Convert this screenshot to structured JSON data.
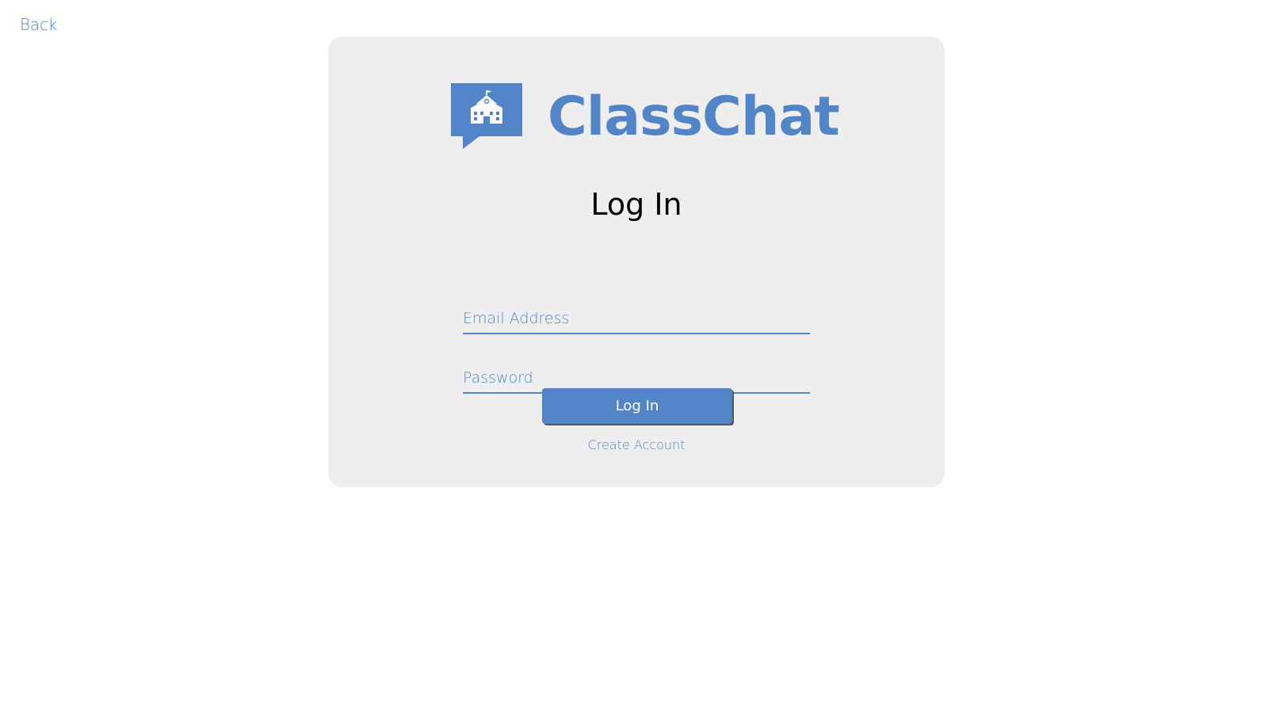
{
  "nav": {
    "back_label": "Back"
  },
  "brand": {
    "name": "ClassChat",
    "icon": "school-chat-bubble-icon"
  },
  "form": {
    "title": "Log In",
    "email_placeholder": "Email Address",
    "password_placeholder": "Password",
    "submit_label": "Log In",
    "create_account_label": "Create Account"
  },
  "colors": {
    "accent": "#5285c7",
    "card_background": "#eeeeee",
    "page_background": "#ffffff",
    "title_text": "#000000"
  }
}
